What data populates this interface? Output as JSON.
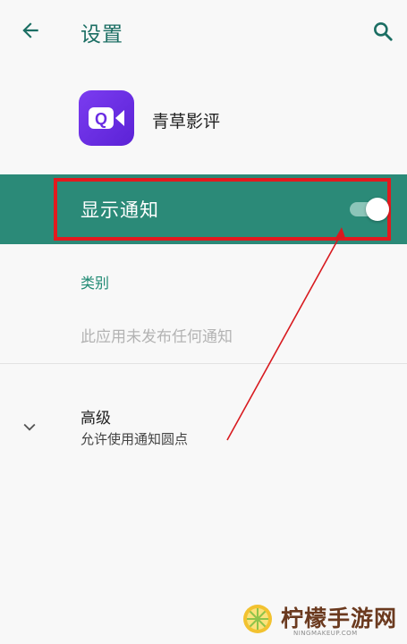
{
  "header": {
    "title": "设置"
  },
  "app": {
    "name": "青草影评"
  },
  "notifications": {
    "label": "显示通知",
    "enabled": true
  },
  "category": {
    "header": "类别",
    "empty_message": "此应用未发布任何通知"
  },
  "advanced": {
    "title": "高级",
    "subtitle": "允许使用通知圆点"
  },
  "watermark": {
    "text": "柠檬手游网",
    "domain": "NINGMAKEUP.COM"
  },
  "colors": {
    "accent": "#1b6e63",
    "highlight_row": "#2b8a78",
    "annotation_red": "#e3191e",
    "app_icon": "#6a2de3"
  },
  "icons": {
    "back": "arrow-left-icon",
    "search": "search-icon",
    "app": "video-camera-q-icon",
    "expand": "chevron-down-icon"
  }
}
